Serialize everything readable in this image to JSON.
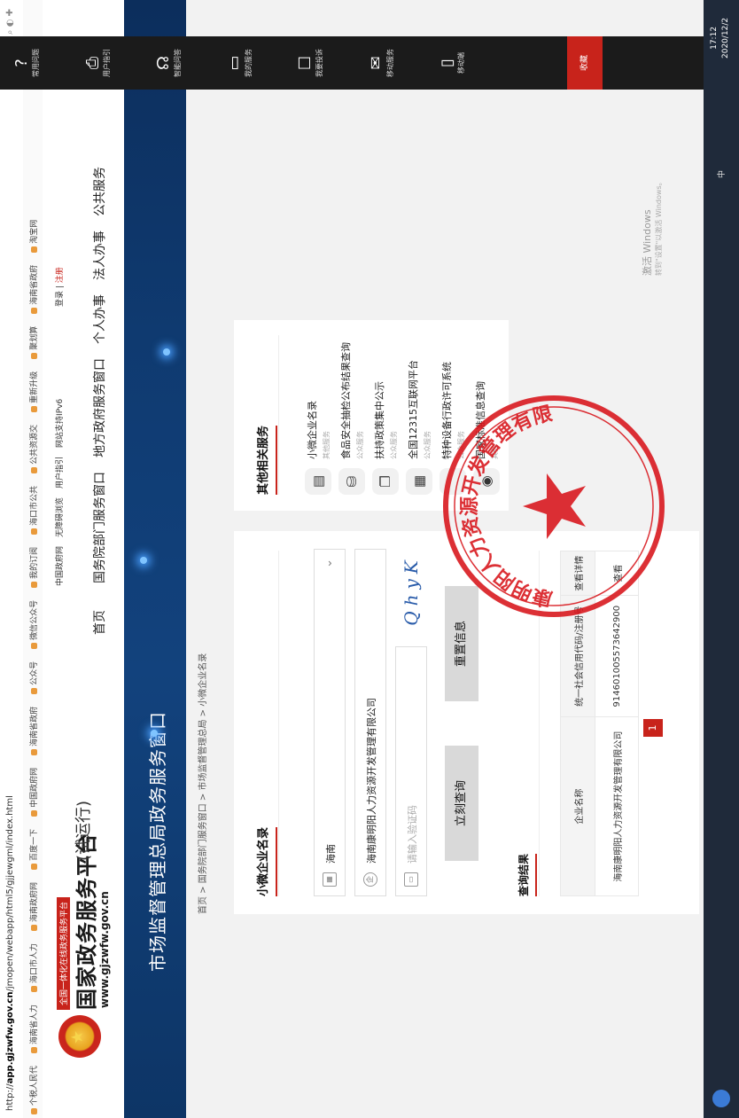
{
  "browser": {
    "url_prefix": "http://",
    "url_host": "app.gjzwfw.gov.cn",
    "url_path": "/jmopen/webapp/html5/gjjewgml/index.html",
    "bookmarks": [
      "个税人民代",
      "海南省人力",
      "海口市人力",
      "海南政府网",
      "百度一下",
      "中国政府网",
      "海南省政府",
      "公众号",
      "微信公众号",
      "我的订阅",
      "海口市公共",
      "公共资源交",
      "重新升级",
      "聚划算",
      "海南省政府",
      "淘宝网"
    ]
  },
  "header": {
    "slogan": "全国一体化在线政务服务平台",
    "site_name": "国家政务服务平台",
    "site_url": "www.gjzwfw.gov.cn",
    "trial": "(试运行)",
    "top_links": [
      "中国政府网",
      "无障碍浏览",
      "用户指引",
      "网站支持IPv6"
    ],
    "login": "登录",
    "register": "注册",
    "nav": [
      "首页",
      "国务院部门服务窗口",
      "地方政府服务窗口",
      "个人办事",
      "法人办事",
      "公共服务"
    ]
  },
  "banner": {
    "title": "市场监督管理总局政务服务窗口"
  },
  "breadcrumb": "首页 > 国务院部门服务窗口 > 市场监督管理总局 > 小微企业名录",
  "search": {
    "title": "小微企业名录",
    "region_value": "海南",
    "company_value": "海南康明阳人力资源开发管理有限公司",
    "captcha_placeholder": "请输入验证码",
    "captcha_code": "QhyK",
    "query_btn": "立刻查询",
    "reset_btn": "重置信息"
  },
  "results": {
    "title": "查询结果",
    "headers": [
      "企业名称",
      "统一社会信用代码/注册号",
      "查看详情"
    ],
    "rows": [
      [
        "海南康明阳人力资源开发管理有限公司",
        "914601005573642900",
        "查看"
      ]
    ],
    "page": "1"
  },
  "services": {
    "title": "其他相关服务",
    "items": [
      {
        "name": "小微企业名录",
        "sub": "其他服务",
        "icon": "▤"
      },
      {
        "name": "食品安全抽检公布结果查询",
        "sub": "公众服务",
        "icon": "⛁"
      },
      {
        "name": "扶持政策集中公示",
        "sub": "公众服务",
        "icon": "❐"
      },
      {
        "name": "全国12315互联网平台",
        "sub": "公众服务",
        "icon": "▦"
      },
      {
        "name": "特种设备行政许可系统",
        "sub": "公众服务",
        "icon": ""
      },
      {
        "name": "国家标准信息查询",
        "sub": "其他",
        "icon": "◉"
      }
    ]
  },
  "floatbar": {
    "items": [
      {
        "icon": "?",
        "label": "常用问题"
      },
      {
        "icon": "⎙",
        "label": "用户指引"
      },
      {
        "icon": "☊",
        "label": "智能问答"
      },
      {
        "icon": "▭",
        "label": "我的服务"
      },
      {
        "icon": "☐",
        "label": "我要投诉"
      },
      {
        "icon": "✉",
        "label": "移动服务"
      },
      {
        "icon": "▯",
        "label": "移动端"
      }
    ],
    "favorite": "收藏"
  },
  "watermark": {
    "line1": "激活 Windows",
    "line2": "转到\"设置\"以激活 Windows。"
  },
  "taskbar": {
    "tray": "中",
    "time": "17:12",
    "date": "2020/12/2"
  },
  "seal": {
    "text": "海南康明阳人力资源开发管理有限公司"
  }
}
